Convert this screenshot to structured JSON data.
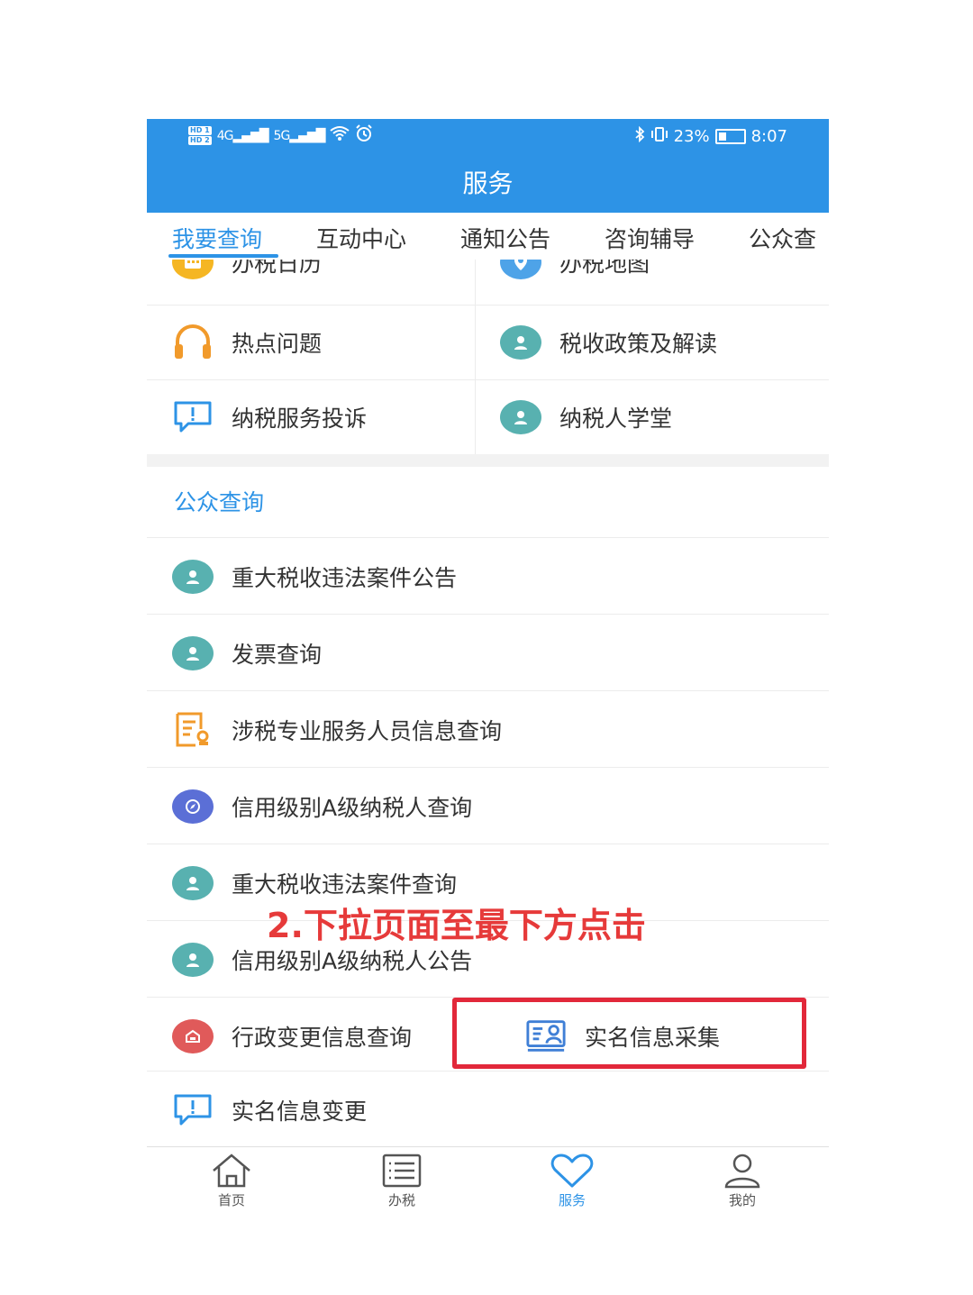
{
  "status_bar": {
    "hd1": "HD 1",
    "hd2": "HD 2",
    "signal1": "4G",
    "signal2": "5G",
    "battery_percent": "23%",
    "time": "8:07"
  },
  "header": {
    "title": "服务"
  },
  "tabs": [
    {
      "label": "我要查询",
      "active": true
    },
    {
      "label": "互动中心",
      "active": false
    },
    {
      "label": "通知公告",
      "active": false
    },
    {
      "label": "咨询辅导",
      "active": false
    },
    {
      "label": "公众查",
      "active": false
    }
  ],
  "grid": {
    "rows": [
      {
        "left": {
          "label": "办税日历",
          "icon": "calendar-icon"
        },
        "right": {
          "label": "办税地图",
          "icon": "map-pin-icon"
        }
      },
      {
        "left": {
          "label": "热点问题",
          "icon": "headphones-icon"
        },
        "right": {
          "label": "税收政策及解读",
          "icon": "user-icon"
        }
      },
      {
        "left": {
          "label": "纳税服务投诉",
          "icon": "complaint-bubble-icon"
        },
        "right": {
          "label": "纳税人学堂",
          "icon": "user-icon"
        }
      }
    ]
  },
  "public_query": {
    "title": "公众查询",
    "items": [
      {
        "label": "重大税收违法案件公告",
        "icon": "user-icon"
      },
      {
        "label": "发票查询",
        "icon": "user-icon"
      },
      {
        "label": "涉税专业服务人员信息查询",
        "icon": "certificate-icon"
      },
      {
        "label": "信用级别A级纳税人查询",
        "icon": "compass-icon"
      },
      {
        "label": "重大税收违法案件查询",
        "icon": "user-icon"
      },
      {
        "label": "信用级别A级纳税人公告",
        "icon": "user-icon"
      },
      {
        "label": "行政变更信息查询",
        "icon": "building-icon"
      },
      {
        "label": "实名信息采集",
        "icon": "id-card-icon"
      },
      {
        "label": "实名信息变更",
        "icon": "complaint-bubble-icon"
      }
    ]
  },
  "annotation": {
    "instruction": "2.下拉页面至最下方点击",
    "highlight_color": "#e2283a"
  },
  "bottom_nav": [
    {
      "label": "首页",
      "icon": "home-icon",
      "active": false
    },
    {
      "label": "办税",
      "icon": "list-icon",
      "active": false
    },
    {
      "label": "服务",
      "icon": "heart-icon",
      "active": true
    },
    {
      "label": "我的",
      "icon": "person-icon",
      "active": false
    }
  ],
  "colors": {
    "brand_blue": "#2d93e6",
    "teal": "#58b1b0",
    "orange": "#f19a2b",
    "red_icon": "#e05a5a",
    "purple_blue": "#5b6fd6",
    "instruction_red": "#e63a3a"
  }
}
